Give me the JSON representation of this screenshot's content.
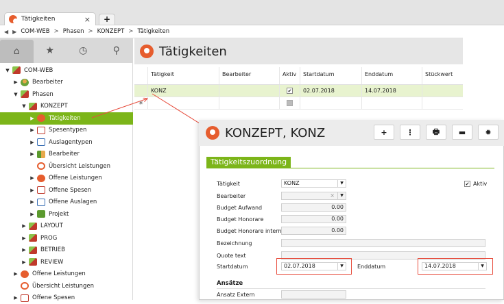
{
  "browser": {
    "tab_title": "Tätigkeiten",
    "tab_close": "×",
    "new_tab": "+"
  },
  "breadcrumb": {
    "back": "◀",
    "forward": "▶",
    "items": [
      "COM-WEB",
      "Phasen",
      "KONZEPT",
      "Tätigkeiten"
    ],
    "separator": ">"
  },
  "sidebar": {
    "tabs": [
      {
        "icon": "home-icon",
        "glyph": "⌂"
      },
      {
        "icon": "star-icon",
        "glyph": "★"
      },
      {
        "icon": "clock-icon",
        "glyph": "◷"
      },
      {
        "icon": "search-icon",
        "glyph": "⚲"
      }
    ],
    "tree": [
      {
        "label": "COM-WEB",
        "indent": 0,
        "arrow": "▼",
        "icon": "folder"
      },
      {
        "label": "Bearbeiter",
        "indent": 1,
        "arrow": "▶",
        "icon": "person"
      },
      {
        "label": "Phasen",
        "indent": 1,
        "arrow": "▼",
        "icon": "folder"
      },
      {
        "label": "KONZEPT",
        "indent": 2,
        "arrow": "▼",
        "icon": "folder"
      },
      {
        "label": "Tätigkeiten",
        "indent": 3,
        "arrow": "▶",
        "icon": "orange",
        "selected": true
      },
      {
        "label": "Spesentypen",
        "indent": 3,
        "arrow": "▶",
        "icon": "doc"
      },
      {
        "label": "Auslagentypen",
        "indent": 3,
        "arrow": "▶",
        "icon": "cal"
      },
      {
        "label": "Bearbeiter",
        "indent": 3,
        "arrow": "▶",
        "icon": "bar"
      },
      {
        "label": "Übersicht Leistungen",
        "indent": 3,
        "arrow": "",
        "icon": "circ"
      },
      {
        "label": "Offene Leistungen",
        "indent": 3,
        "arrow": "▶",
        "icon": "orange"
      },
      {
        "label": "Offene Spesen",
        "indent": 3,
        "arrow": "▶",
        "icon": "doc"
      },
      {
        "label": "Offene Auslagen",
        "indent": 3,
        "arrow": "▶",
        "icon": "cal"
      },
      {
        "label": "Projekt",
        "indent": 3,
        "arrow": "▶",
        "icon": "green"
      },
      {
        "label": "LAYOUT",
        "indent": 2,
        "arrow": "▶",
        "icon": "folder"
      },
      {
        "label": "PROG",
        "indent": 2,
        "arrow": "▶",
        "icon": "folder"
      },
      {
        "label": "BETRIEB",
        "indent": 2,
        "arrow": "▶",
        "icon": "folder"
      },
      {
        "label": "REVIEW",
        "indent": 2,
        "arrow": "▶",
        "icon": "folder"
      },
      {
        "label": "Offene Leistungen",
        "indent": 1,
        "arrow": "▶",
        "icon": "orange"
      },
      {
        "label": "Übersicht Leistungen",
        "indent": 1,
        "arrow": "",
        "icon": "circ"
      },
      {
        "label": "Offene Spesen",
        "indent": 1,
        "arrow": "▶",
        "icon": "doc"
      }
    ]
  },
  "main": {
    "title": "Tätigkeiten",
    "columns": [
      "Tätigkeit",
      "Bearbeiter",
      "Aktiv",
      "Startdatum",
      "Enddatum",
      "Stückwert"
    ],
    "rows": [
      {
        "marker": "",
        "taetigkeit": "KONZ",
        "bearbeiter": "",
        "aktiv": "✔",
        "start": "02.07.2018",
        "end": "14.07.2018",
        "stueck": ""
      },
      {
        "marker": "✳",
        "taetigkeit": "",
        "bearbeiter": "",
        "aktiv": "",
        "start": "",
        "end": "",
        "stueck": ""
      }
    ]
  },
  "dialog": {
    "title": "KONZEPT, KONZ",
    "buttons": {
      "add": "+",
      "more": "⋮",
      "print": "🖶",
      "folder": "▬",
      "settings": "✹"
    },
    "section": "Tätigkeitszuordnung",
    "fields": {
      "taetigkeit_label": "Tätigkeit",
      "taetigkeit_value": "KONZ",
      "aktiv_label": "Aktiv",
      "aktiv_check": "✔",
      "bearbeiter_label": "Bearbeiter",
      "bearbeiter_clear": "×",
      "budget_aufwand_label": "Budget Aufwand",
      "budget_aufwand_value": "0.00",
      "budget_honorare_label": "Budget Honorare",
      "budget_honorare_value": "0.00",
      "budget_honorare_intern_label": "Budget Honorare intern",
      "budget_honorare_intern_value": "0.00",
      "bezeichnung_label": "Bezeichnung",
      "quote_text_label": "Quote text",
      "startdatum_label": "Startdatum",
      "startdatum_value": "02.07.2018",
      "enddatum_label": "Enddatum",
      "enddatum_value": "14.07.2018",
      "ansaetze_label": "Ansätze",
      "ansatz_extern_label": "Ansatz Extern"
    },
    "dropdown_glyph": "▼"
  },
  "colors": {
    "accent": "#7cb519",
    "logo": "#e65d2e",
    "highlight_row": "#e8f3cf",
    "annotation": "#e74c3c"
  }
}
